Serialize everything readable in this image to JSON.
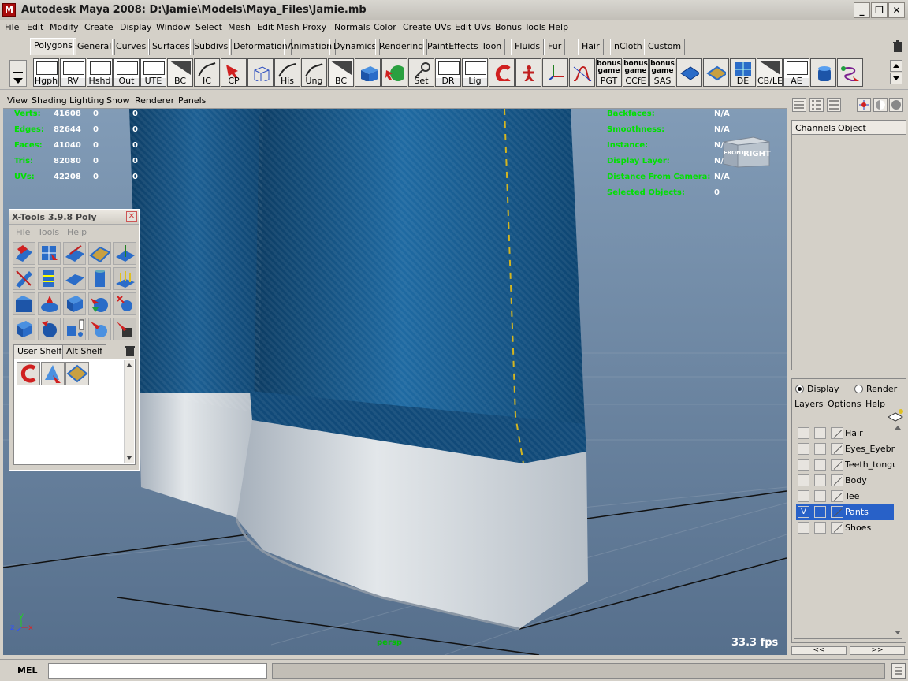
{
  "window": {
    "title": "Autodesk Maya 2008: D:\\Jamie\\Models\\Maya_Files\\Jamie.mb",
    "app_icon": "maya-logo-icon",
    "minimize": "_",
    "maximize": "❐",
    "close": "✕"
  },
  "menubar": [
    "File",
    "Edit",
    "Modify",
    "Create",
    "Display",
    "Window",
    "Select",
    "Mesh",
    "Edit Mesh",
    "Proxy",
    "Normals",
    "Color",
    "Create UVs",
    "Edit UVs",
    "Bonus Tools",
    "Help"
  ],
  "shelf_tabs": [
    "Polygons",
    "General",
    "Curves",
    "Surfaces",
    "Subdivs",
    "Deformation",
    "Animation",
    "Dynamics",
    "Rendering",
    "PaintEffects",
    "Toon",
    "Fluids",
    "Fur",
    "Hair",
    "nCloth",
    "Custom"
  ],
  "shelf_buttons": [
    "Hgph",
    "RV",
    "Hshd",
    "Out",
    "UTE",
    "BC",
    "IC",
    "CP",
    "",
    "His",
    "Ung",
    "BC",
    "",
    "",
    "Set",
    "DR",
    "Lig",
    "",
    "",
    "",
    "",
    "PGT",
    "CCfE",
    "SAS",
    "",
    "",
    "DE",
    "CB/LE",
    "AE",
    "",
    ""
  ],
  "shelf_button_top_labels": {
    "PGT": "bonus game",
    "CCfE": "bonus game",
    "SAS": "bonus game"
  },
  "viewport": {
    "menu": [
      "View",
      "Shading",
      "Lighting",
      "Show",
      "Renderer",
      "Panels"
    ],
    "hud_left": [
      {
        "label": "Verts:",
        "a": "41608",
        "b": "0",
        "c": "0"
      },
      {
        "label": "Edges:",
        "a": "82644",
        "b": "0",
        "c": "0"
      },
      {
        "label": "Faces:",
        "a": "41040",
        "b": "0",
        "c": "0"
      },
      {
        "label": "Tris:",
        "a": "82080",
        "b": "0",
        "c": "0"
      },
      {
        "label": "UVs:",
        "a": "42208",
        "b": "0",
        "c": "0"
      }
    ],
    "hud_right": [
      {
        "label": "Backfaces:",
        "v": "N/A"
      },
      {
        "label": "Smoothness:",
        "v": "N/A"
      },
      {
        "label": "Instance:",
        "v": "N/A"
      },
      {
        "label": "Display Layer:",
        "v": "N/A"
      },
      {
        "label": "Distance From Camera:",
        "v": "N/A"
      },
      {
        "label": "Selected Objects:",
        "v": "0"
      }
    ],
    "viewcube": {
      "front": "FRONT",
      "right": "RIGHT"
    },
    "camera": "persp",
    "fps": "33.3 fps",
    "axis": {
      "x": "x",
      "y": "y",
      "z": "z"
    }
  },
  "xtools": {
    "title": "X-Tools 3.9.8 Poly",
    "menu": [
      "File",
      "Tools",
      "Help"
    ],
    "tabs": [
      "User Shelf",
      "Alt Shelf"
    ],
    "close": "✕"
  },
  "right_panel": {
    "channels_tabs": [
      "Channels",
      "Object"
    ],
    "display_modes": [
      "Display",
      "Render"
    ],
    "layer_menu": [
      "Layers",
      "Options",
      "Help"
    ],
    "layers": [
      {
        "name": "Hair",
        "v": "",
        "selected": false
      },
      {
        "name": "Eyes_Eyebro",
        "v": "",
        "selected": false
      },
      {
        "name": "Teeth_tongu",
        "v": "",
        "selected": false
      },
      {
        "name": "Body",
        "v": "",
        "selected": false
      },
      {
        "name": "Tee",
        "v": "",
        "selected": false
      },
      {
        "name": "Pants",
        "v": "V",
        "selected": true
      },
      {
        "name": "Shoes",
        "v": "",
        "selected": false
      }
    ],
    "nav": [
      "<<",
      ">>"
    ]
  },
  "statusbar": {
    "mel_label": "MEL",
    "mel_value": ""
  }
}
